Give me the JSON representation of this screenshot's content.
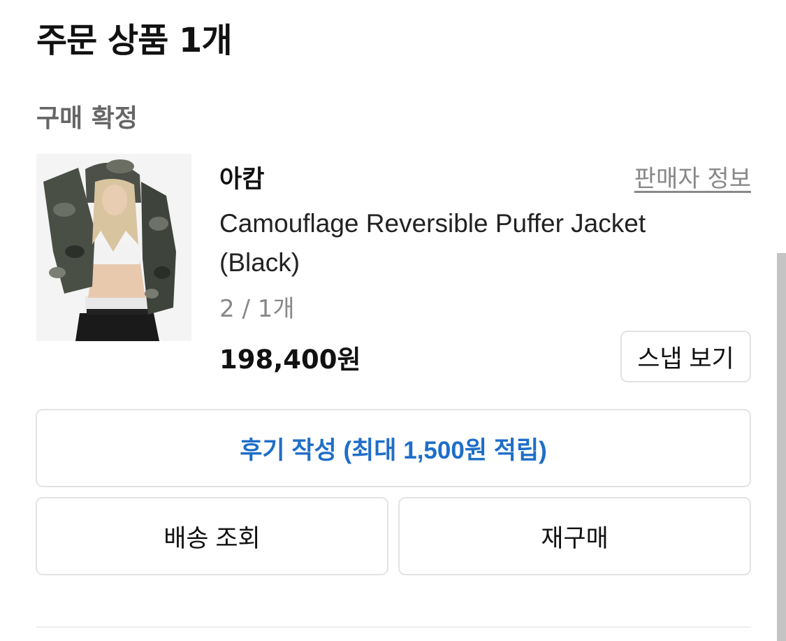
{
  "order": {
    "title": "주문 상품 1개",
    "status": "구매 확정"
  },
  "product": {
    "brand": "아캄",
    "seller_info_label": "판매자 정보",
    "name": "Camouflage Reversible Puffer Jacket (Black)",
    "option": "2 / 1개",
    "price": "198,400원",
    "thumbnail_icon": "product-photo"
  },
  "actions": {
    "snap_label": "스냅 보기",
    "review_label": "후기 작성 (최대 1,500원 적립)",
    "delivery_label": "배송 조회",
    "rebuy_label": "재구매"
  },
  "colors": {
    "accent": "#1e6ec8",
    "muted_text": "#888888",
    "border": "#e3e3e3"
  }
}
